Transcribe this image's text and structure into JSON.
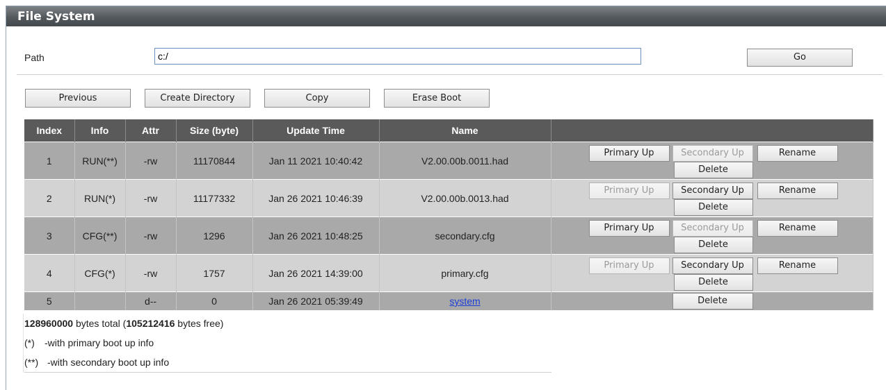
{
  "window": {
    "title": "File System"
  },
  "path": {
    "label": "Path",
    "value": "c:/",
    "go_label": "Go"
  },
  "toolbar": {
    "previous": "Previous",
    "create_directory": "Create Directory",
    "copy": "Copy",
    "erase_boot": "Erase Boot"
  },
  "table": {
    "headers": [
      "Index",
      "Info",
      "Attr",
      "Size (byte)",
      "Update Time",
      "Name",
      ""
    ],
    "rows": [
      {
        "index": "1",
        "info": "RUN(**)",
        "attr": "-rw",
        "size": "11170844",
        "time": "Jan 11 2021 10:40:42",
        "name": "V2.00.00b.0011.had",
        "primary_enabled": true,
        "secondary_enabled": false
      },
      {
        "index": "2",
        "info": "RUN(*)",
        "attr": "-rw",
        "size": "11177332",
        "time": "Jan 26 2021 10:46:39",
        "name": "V2.00.00b.0013.had",
        "primary_enabled": false,
        "secondary_enabled": true
      },
      {
        "index": "3",
        "info": "CFG(**)",
        "attr": "-rw",
        "size": "1296",
        "time": "Jan 26 2021 10:48:25",
        "name": "secondary.cfg",
        "primary_enabled": true,
        "secondary_enabled": false
      },
      {
        "index": "4",
        "info": "CFG(*)",
        "attr": "-rw",
        "size": "1757",
        "time": "Jan 26 2021 14:39:00",
        "name": "primary.cfg",
        "primary_enabled": false,
        "secondary_enabled": true
      },
      {
        "index": "5",
        "info": "",
        "attr": "d--",
        "size": "0",
        "time": "Jan 26 2021 05:39:49",
        "name": "system"
      }
    ],
    "actions": {
      "primary_up": "Primary Up",
      "secondary_up": "Secondary Up",
      "rename": "Rename",
      "delete": "Delete"
    }
  },
  "footer": {
    "total_bytes": "128960000",
    "total_text_mid": " bytes total (",
    "free_bytes": "105212416",
    "free_text_end": " bytes free)",
    "legend1_mark": "(*)",
    "legend1_text": "-with primary boot up info",
    "legend2_mark": "(**)",
    "legend2_text": "-with secondary boot up info"
  }
}
